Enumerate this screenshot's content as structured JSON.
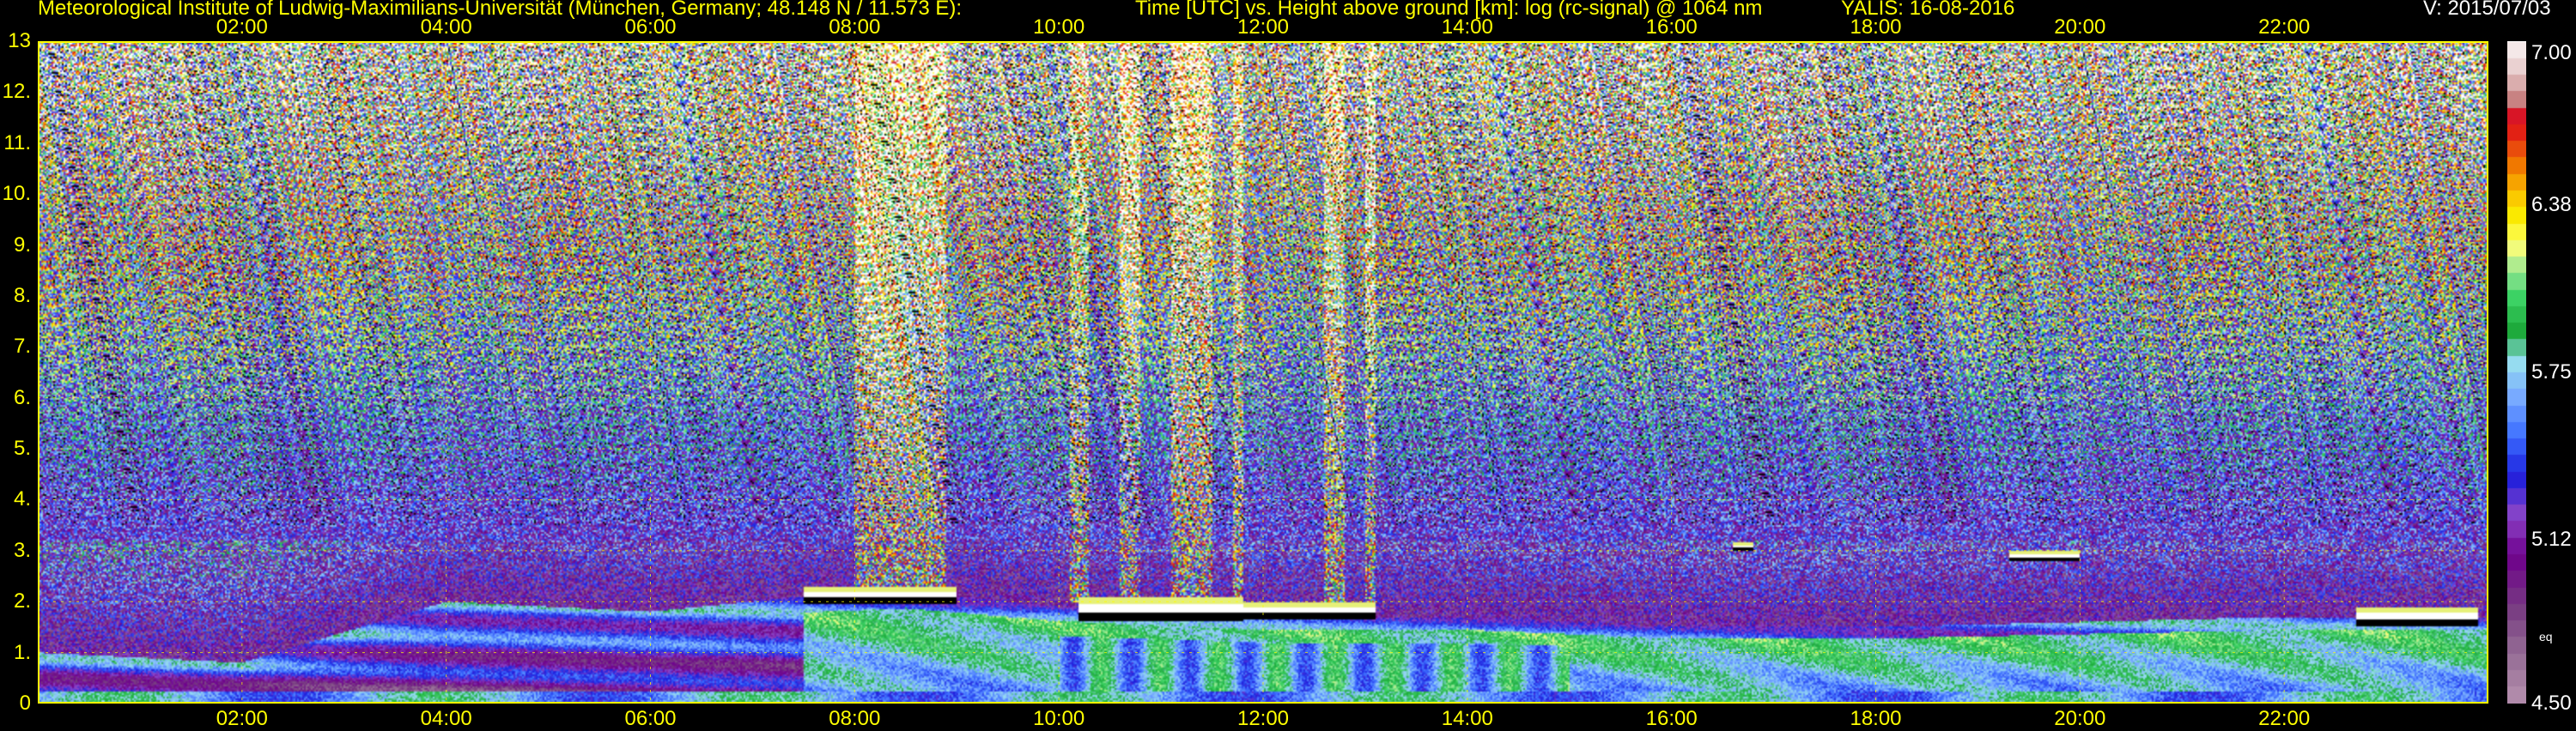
{
  "header": {
    "institute": "Meteorological Institute of Ludwig-Maximilians-Universität (München, Germany; 48.148 N / 11.573 E):",
    "title": "Time [UTC] vs. Height above ground [km]: log (rc-signal) @ 1064 nm",
    "instrument": "YALIS: 16-08-2016",
    "version": "V: 2015/07/03"
  },
  "colors": {
    "background": "#000000",
    "axis_text": "#ffff00",
    "grid": "#ffff00",
    "colorbar_text": "#ffffff"
  },
  "chart_data": {
    "type": "heatmap",
    "xaxis": {
      "quantity": "Time [UTC]",
      "range_hours": [
        0,
        24
      ],
      "ticks": [
        "02:00",
        "04:00",
        "06:00",
        "08:00",
        "10:00",
        "12:00",
        "14:00",
        "16:00",
        "18:00",
        "20:00",
        "22:00"
      ],
      "tick_values_hours": [
        2,
        4,
        6,
        8,
        10,
        12,
        14,
        16,
        18,
        20,
        22
      ],
      "labels_top_and_bottom": true
    },
    "yaxis": {
      "quantity": "Height above ground [km]",
      "range_km": [
        0,
        13
      ],
      "ticks": [
        "0",
        "1.",
        "2.",
        "3.",
        "4.",
        "5.",
        "6.",
        "7.",
        "8.",
        "9.",
        "10.",
        "11.",
        "12.",
        "13"
      ],
      "tick_values_km": [
        0,
        1,
        2,
        3,
        4,
        5,
        6,
        7,
        8,
        9,
        10,
        11,
        12,
        13
      ]
    },
    "colorbar": {
      "quantity": "log (rc-signal)",
      "range": [
        4.5,
        7.0
      ],
      "ticks": [
        "4.50",
        "5.12",
        "5.75",
        "6.38",
        "7.00"
      ],
      "tick_values": [
        4.5,
        5.12,
        5.75,
        6.38,
        7.0
      ],
      "unit_label": "eq"
    },
    "grid": true,
    "features": {
      "boundary_layer_top_km": [
        [
          0,
          1.0
        ],
        [
          2,
          0.8
        ],
        [
          4,
          2.0
        ],
        [
          6,
          1.8
        ],
        [
          7.5,
          2.1
        ],
        [
          8.5,
          2.2
        ],
        [
          10,
          1.9
        ],
        [
          11,
          1.8
        ],
        [
          12,
          1.7
        ],
        [
          13,
          1.7
        ],
        [
          14,
          1.7
        ],
        [
          16,
          1.5
        ],
        [
          18,
          1.5
        ],
        [
          20,
          1.6
        ],
        [
          22,
          1.7
        ],
        [
          24,
          1.7
        ]
      ],
      "cloud_layers": [
        {
          "start_hour": 7.5,
          "end_hour": 9.0,
          "base_km": 1.95,
          "top_km": 2.3
        },
        {
          "start_hour": 10.2,
          "end_hour": 11.8,
          "base_km": 1.6,
          "top_km": 2.1
        },
        {
          "start_hour": 11.8,
          "end_hour": 13.1,
          "base_km": 1.65,
          "top_km": 2.0
        },
        {
          "start_hour": 16.6,
          "end_hour": 16.8,
          "base_km": 3.0,
          "top_km": 3.15
        },
        {
          "start_hour": 19.3,
          "end_hour": 20.0,
          "base_km": 2.8,
          "top_km": 3.0
        },
        {
          "start_hour": 22.7,
          "end_hour": 23.9,
          "base_km": 1.5,
          "top_km": 1.9
        }
      ],
      "noise_columns_hours": [
        [
          8.0,
          8.9
        ],
        [
          10.1,
          10.3
        ],
        [
          10.6,
          10.8
        ],
        [
          11.1,
          11.5
        ],
        [
          11.7,
          11.8
        ],
        [
          12.6,
          12.8
        ],
        [
          13.0,
          13.1
        ]
      ]
    }
  }
}
